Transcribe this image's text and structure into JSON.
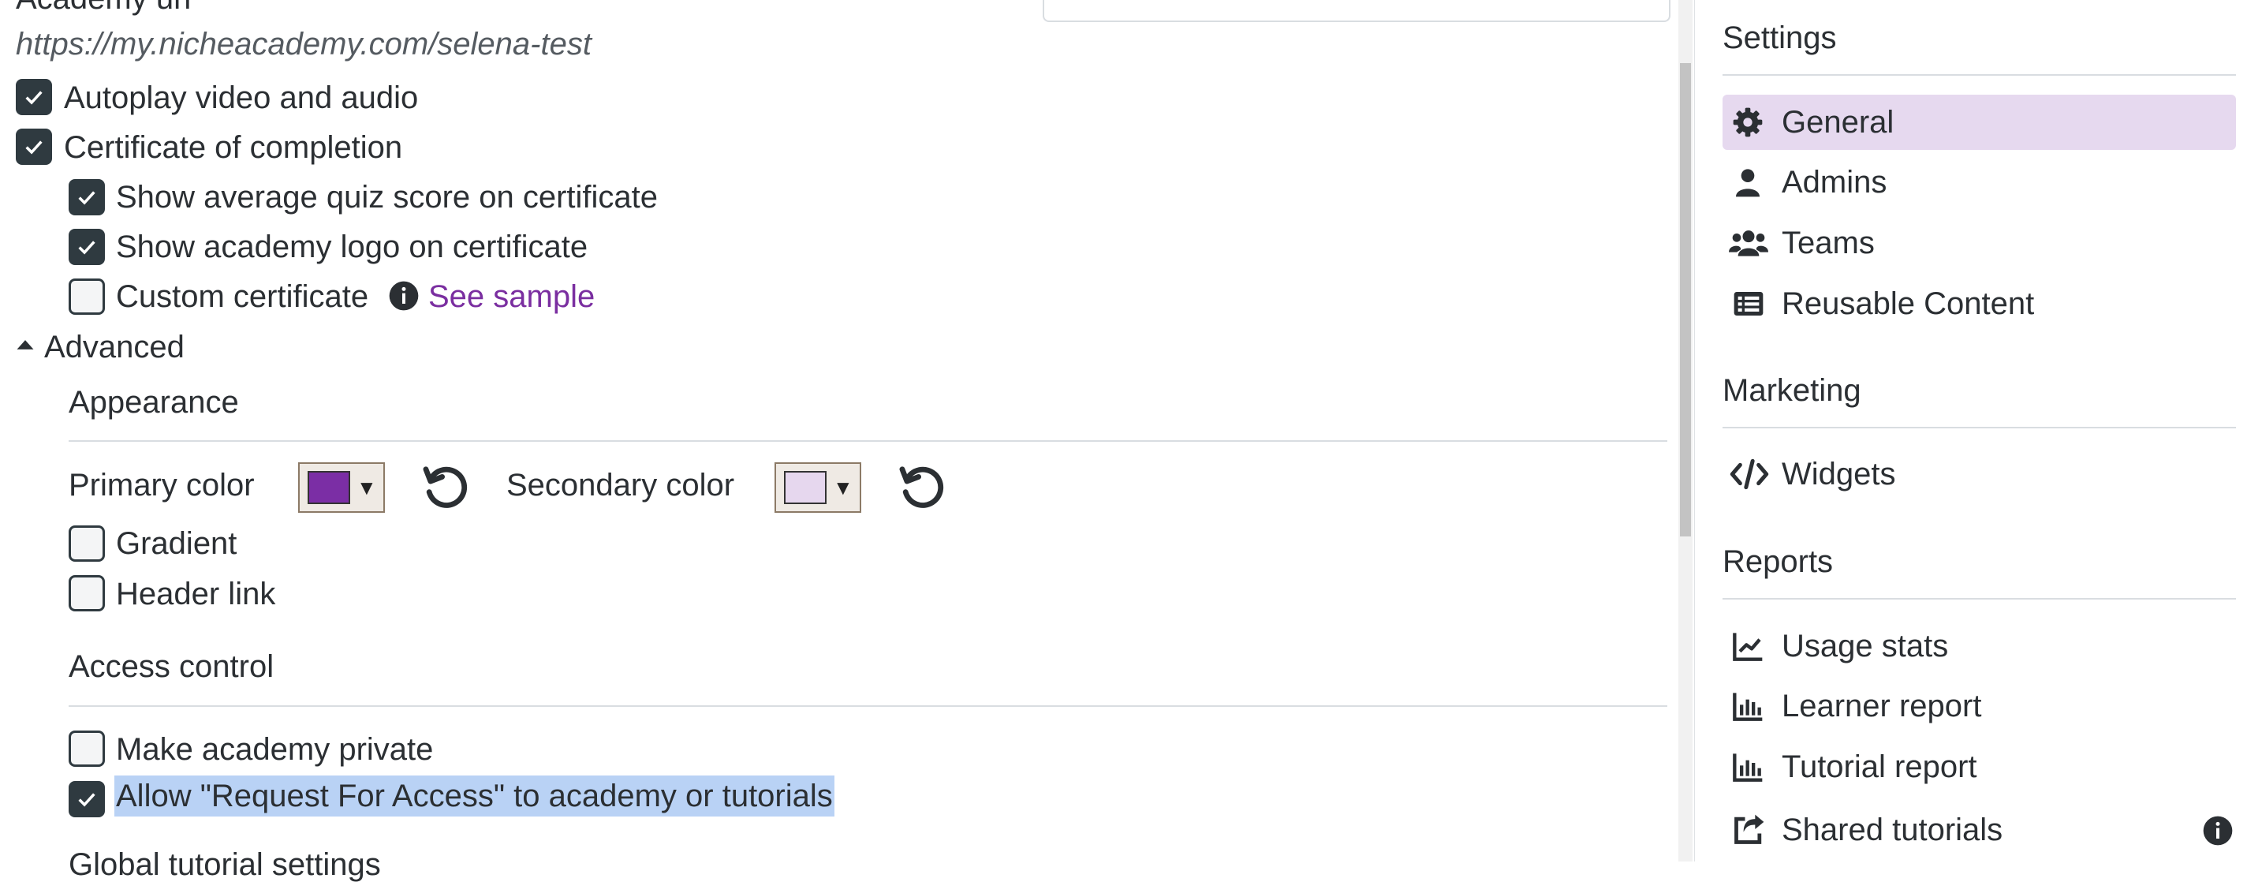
{
  "general": {
    "academy_url_label": "Academy url",
    "academy_url_value": "https://my.nicheacademy.com/selena-test",
    "autoplay_label": "Autoplay video and audio",
    "autoplay_checked": true,
    "certificate_label": "Certificate of completion",
    "certificate_checked": true,
    "show_quiz_label": "Show average quiz score on certificate",
    "show_quiz_checked": true,
    "show_logo_label": "Show academy logo on certificate",
    "show_logo_checked": true,
    "custom_cert_label": "Custom certificate",
    "custom_cert_checked": false,
    "see_sample_link": "See sample"
  },
  "advanced": {
    "toggle_label": "Advanced",
    "appearance_heading": "Appearance",
    "primary_color_label": "Primary color",
    "primary_color_value": "#7b2ea5",
    "secondary_color_label": "Secondary color",
    "secondary_color_value": "#e6d7ee",
    "gradient_label": "Gradient",
    "gradient_checked": false,
    "header_link_label": "Header link",
    "header_link_checked": false,
    "access_heading": "Access control",
    "private_label": "Make academy private",
    "private_checked": false,
    "request_access_label": "Allow \"Request For Access\" to academy or tutorials",
    "request_access_checked": true,
    "next_heading_partial": "Global tutorial settings"
  },
  "sidebar": {
    "settings_heading": "Settings",
    "settings_items": [
      {
        "label": "General",
        "icon": "gear-icon",
        "active": true
      },
      {
        "label": "Admins",
        "icon": "user-icon",
        "active": false
      },
      {
        "label": "Teams",
        "icon": "users-icon",
        "active": false
      },
      {
        "label": "Reusable Content",
        "icon": "list-icon",
        "active": false
      }
    ],
    "marketing_heading": "Marketing",
    "marketing_items": [
      {
        "label": "Widgets",
        "icon": "code-icon"
      }
    ],
    "reports_heading": "Reports",
    "reports_items": [
      {
        "label": "Usage stats",
        "icon": "line-chart-icon"
      },
      {
        "label": "Learner report",
        "icon": "bar-chart-icon"
      },
      {
        "label": "Tutorial report",
        "icon": "bar-chart-icon"
      },
      {
        "label": "Shared tutorials",
        "icon": "share-icon"
      }
    ]
  },
  "colors": {
    "accent": "#7a2ea0",
    "active_nav_bg": "#e6d9ef",
    "checkbox_dark": "#2f3a40",
    "selection_highlight": "#b9d2f5"
  }
}
